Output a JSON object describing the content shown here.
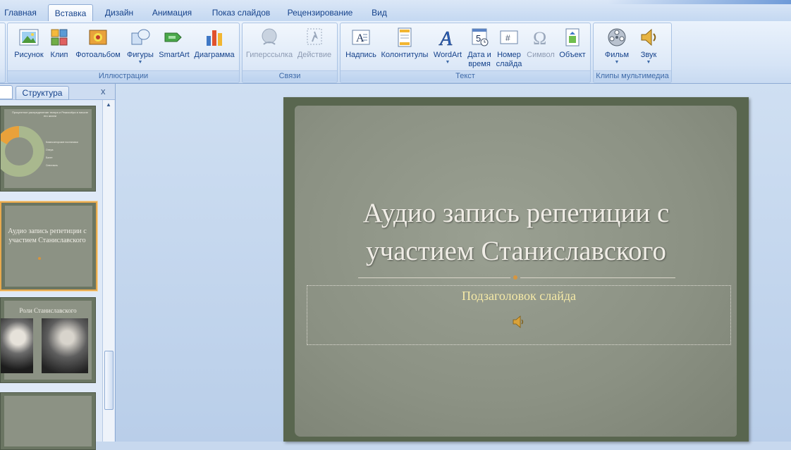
{
  "ribbon": {
    "tabs": [
      {
        "label": "Главная"
      },
      {
        "label": "Вставка",
        "active": true
      },
      {
        "label": "Дизайн"
      },
      {
        "label": "Анимация"
      },
      {
        "label": "Показ слайдов"
      },
      {
        "label": "Рецензирование"
      },
      {
        "label": "Вид"
      }
    ],
    "groups": {
      "illustrations": {
        "label": "Иллюстрации",
        "buttons": [
          "Рисунок",
          "Клип",
          "Фотоальбом",
          "Фигуры",
          "SmartArt",
          "Диаграмма"
        ]
      },
      "links": {
        "label": "Связи",
        "buttons": [
          "Гиперссылка",
          "Действие"
        ]
      },
      "text": {
        "label": "Текст",
        "buttons": [
          "Надпись",
          "Колонтитулы",
          "WordArt",
          "Дата и время",
          "Номер слайда",
          "Символ",
          "Объект"
        ]
      },
      "media": {
        "label": "Клипы мультимедиа",
        "buttons": [
          "Фильм",
          "Звук"
        ]
      }
    }
  },
  "left_pane": {
    "structure_tab": "Структура",
    "close_glyph": "x",
    "thumbnails": [
      {
        "title": "Процентное распределение театра и Режиссёра в начале его жизни",
        "legend": [
          "Композиторские постановки",
          "Опера",
          "Балет",
          "Спектакль"
        ]
      },
      {
        "title": "Аудио запись репетиции с участием Станиславского",
        "selected": true
      },
      {
        "title": "Роли Станиславского"
      },
      {
        "title": ""
      }
    ]
  },
  "slide": {
    "title_line1": "Аудио запись репетиции с",
    "title_line2": "участием Станиславского",
    "subtitle_placeholder": "Подзаголовок слайда",
    "icons": [
      "speaker-icon"
    ]
  },
  "colors": {
    "ribbon_text": "#15428b",
    "slide_frame": "#59664f",
    "slide_paper": "#8b9183",
    "subtitle_color": "#f6eaa7",
    "selected_thumb_border": "#e7a94d"
  }
}
